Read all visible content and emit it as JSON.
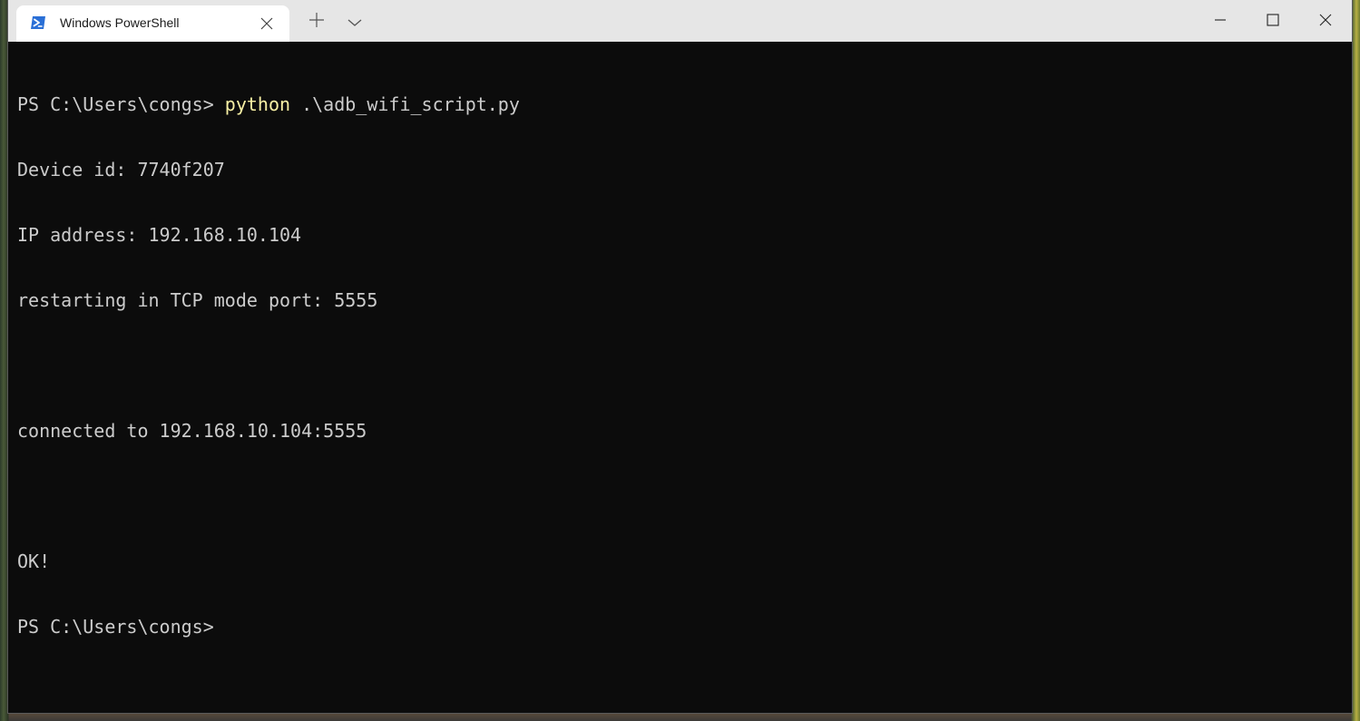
{
  "window": {
    "tab_title": "Windows PowerShell",
    "tab_icon": "powershell-icon",
    "caption_buttons": [
      "minimize-icon",
      "maximize-icon",
      "close-icon"
    ],
    "new_tab_icon": "plus-icon",
    "dropdown_icon": "chevron-down-icon"
  },
  "terminal": {
    "lines": [
      {
        "prompt": "PS C:\\Users\\congs> ",
        "command": "python",
        "args": " .\\adb_wifi_script.py"
      },
      {
        "text": "Device id: 7740f207"
      },
      {
        "text": "IP address: 192.168.10.104"
      },
      {
        "text": "restarting in TCP mode port: 5555"
      },
      {
        "text": ""
      },
      {
        "text": "connected to 192.168.10.104:5555"
      },
      {
        "text": ""
      },
      {
        "text": "OK!"
      },
      {
        "text": "PS C:\\Users\\congs>"
      }
    ]
  },
  "colors": {
    "terminal_bg": "#0c0c0c",
    "terminal_fg": "#cccccc",
    "command_fg": "#f9f1a5",
    "titlebar_bg": "#e6e6e6",
    "tab_bg": "#ffffff",
    "powershell_icon_bg": "#2a6fd6"
  }
}
